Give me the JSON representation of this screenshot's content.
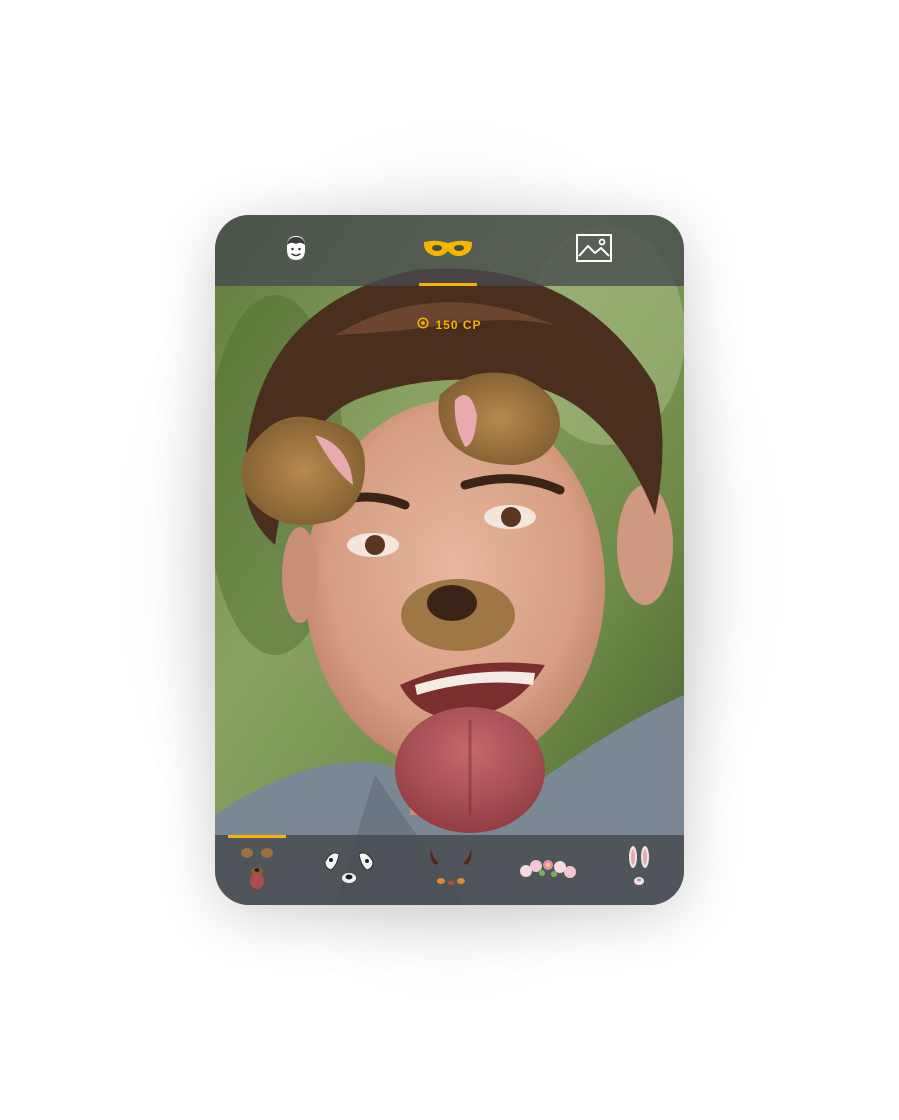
{
  "top_tabs": [
    {
      "name": "face",
      "icon": "face-icon"
    },
    {
      "name": "masks",
      "icon": "mask-icon",
      "selected": true
    },
    {
      "name": "gallery",
      "icon": "image-icon"
    }
  ],
  "credits": {
    "icon": "coin-icon",
    "label": "150 CP"
  },
  "filters": [
    {
      "name": "dog",
      "icon": "dog-filter-icon",
      "selected": true
    },
    {
      "name": "dalmatian",
      "icon": "dalmatian-filter-icon"
    },
    {
      "name": "devil",
      "icon": "devil-filter-icon"
    },
    {
      "name": "flower-crown",
      "icon": "flower-crown-filter-icon"
    },
    {
      "name": "bunny",
      "icon": "bunny-filter-icon"
    }
  ],
  "colors": {
    "accent": "#f5b400",
    "bar": "#464a4e"
  }
}
